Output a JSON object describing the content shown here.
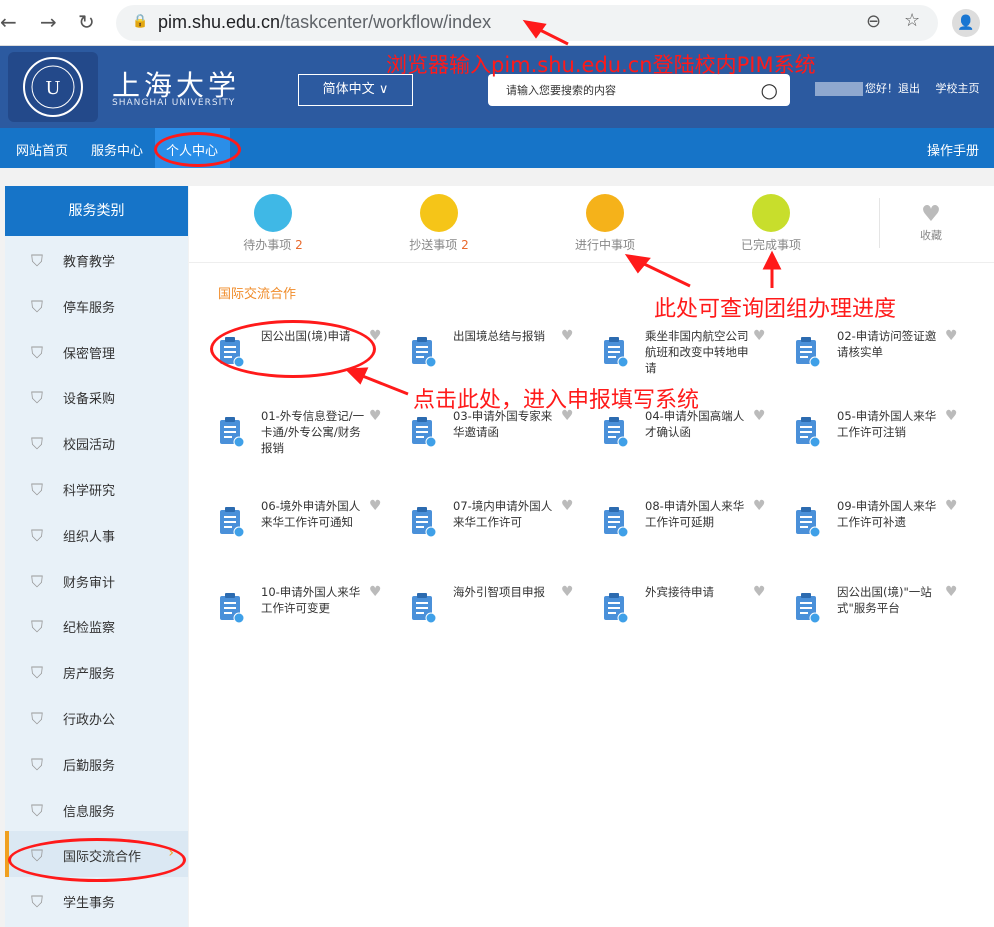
{
  "browser": {
    "url_host": "pim.shu.edu.cn",
    "url_path": "/taskcenter/workflow/index"
  },
  "header": {
    "logo_cn": "上海大学",
    "logo_en": "SHANGHAI UNIVERSITY",
    "lang": "简体中文",
    "search_placeholder": "请输入您要搜索的内容",
    "greeting": "您好！",
    "logout": "退出",
    "school_home": "学校主页"
  },
  "annotations": {
    "login": "浏览器输入pim.shu.edu.cn登陆校内PIM系统",
    "progress": "此处可查询团组办理进度",
    "click": "点击此处，进入申报填写系统"
  },
  "nav": {
    "items": [
      "网站首页",
      "服务中心",
      "个人中心"
    ],
    "manual": "操作手册"
  },
  "sidebar": {
    "title": "服务类别",
    "items": [
      "教育教学",
      "停车服务",
      "保密管理",
      "设备采购",
      "校园活动",
      "科学研究",
      "组织人事",
      "财务审计",
      "纪检监察",
      "房产服务",
      "行政办公",
      "后勤服务",
      "信息服务",
      "国际交流合作",
      "学生事务"
    ]
  },
  "stats": [
    {
      "label": "待办事项",
      "count": "2"
    },
    {
      "label": "抄送事项",
      "count": "2"
    },
    {
      "label": "进行中事项",
      "count": ""
    },
    {
      "label": "已完成事项",
      "count": ""
    }
  ],
  "favorite": "收藏",
  "section_title": "国际交流合作",
  "cards": [
    "因公出国(境)申请",
    "出国境总结与报销",
    "乘坐非国内航空公司航班和改变中转地申请",
    "02-申请访问签证邀请核实单",
    "01-外专信息登记/一卡通/外专公寓/财务报销",
    "03-申请外国专家来华邀请函",
    "04-申请外国高端人才确认函",
    "05-申请外国人来华工作许可注销",
    "06-境外申请外国人来华工作许可通知",
    "07-境内申请外国人来华工作许可",
    "08-申请外国人来华工作许可延期",
    "09-申请外国人来华工作许可补遗",
    "10-申请外国人来华工作许可变更",
    "海外引智项目申报",
    "外宾接待申请",
    "因公出国(境)\"一站式\"服务平台"
  ],
  "colors": {
    "header": "#2c5aa0",
    "nav": "#1674c8",
    "accent": "#f08c2a",
    "annotation": "#ff1a1a"
  }
}
